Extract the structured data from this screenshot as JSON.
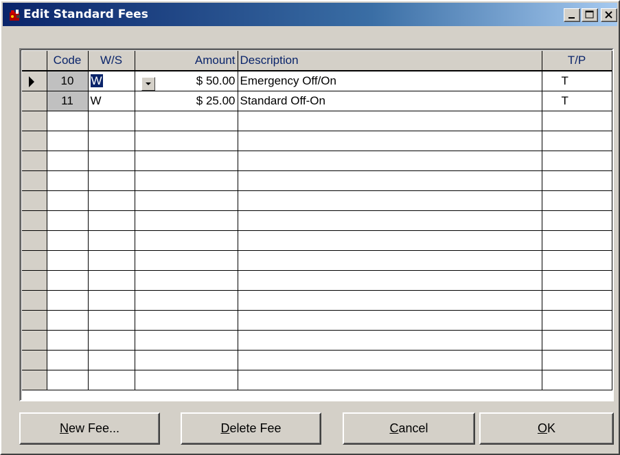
{
  "window": {
    "title": "Edit Standard Fees"
  },
  "titlebar_buttons": [
    "minimize",
    "maximize",
    "close"
  ],
  "grid": {
    "columns": [
      "Code",
      "W/S",
      "Amount",
      "Description",
      "T/P"
    ],
    "rows": [
      {
        "code": "10",
        "ws": "W",
        "amount": "$ 50.00",
        "description": "Emergency Off/On",
        "tp": "T",
        "current": true
      },
      {
        "code": "11",
        "ws": "W",
        "amount": "$ 25.00",
        "description": "Standard Off-On",
        "tp": "T",
        "current": false
      }
    ]
  },
  "buttons": {
    "new_fee": {
      "mnemonic": "N",
      "rest": "ew Fee..."
    },
    "delete_fee": {
      "mnemonic": "D",
      "rest": "elete Fee"
    },
    "cancel": {
      "mnemonic": "C",
      "rest": "ancel"
    },
    "ok": {
      "mnemonic": "O",
      "rest": "K"
    }
  },
  "colors": {
    "title_gradient_start": "#0a246a",
    "title_gradient_end": "#a6caf0",
    "header_text": "#0a246a",
    "selection": "#0a246a"
  }
}
